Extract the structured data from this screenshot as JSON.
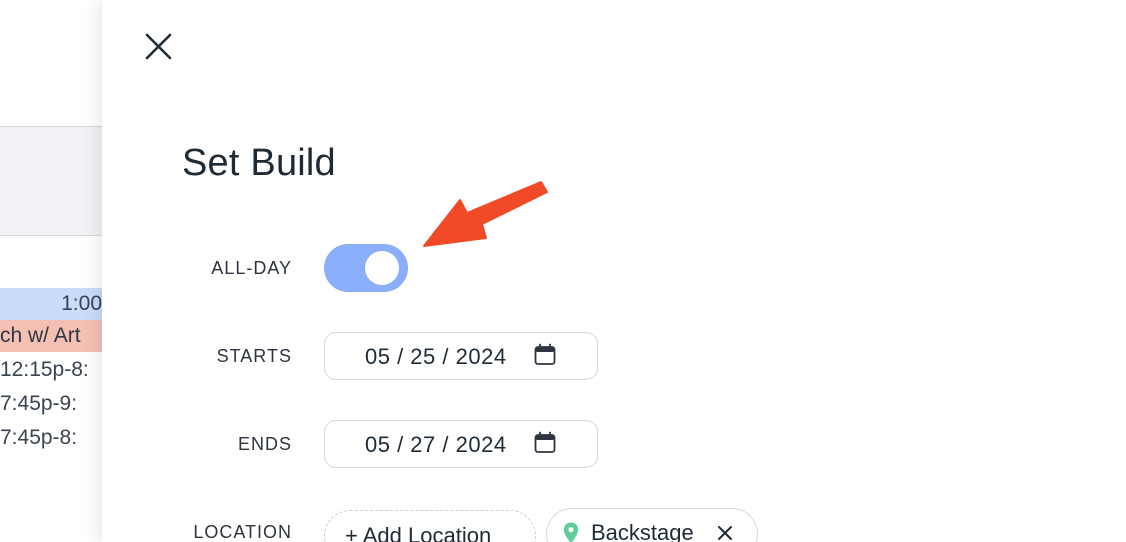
{
  "background_calendar": {
    "rows": [
      {
        "text": "1:00"
      },
      {
        "text": "ch w/ Art"
      },
      {
        "text": "12:15p-8:"
      },
      {
        "text": "7:45p-9:"
      },
      {
        "text": "7:45p-8:"
      }
    ]
  },
  "drawer": {
    "title": "Set Build",
    "close_icon": "close-icon",
    "all_day": {
      "label": "ALL-DAY",
      "on": true,
      "color": "#8aaef9"
    },
    "starts": {
      "label": "STARTS",
      "value": "05 / 25 / 2024",
      "icon": "calendar-icon"
    },
    "ends": {
      "label": "ENDS",
      "value": "05 / 27 / 2024",
      "icon": "calendar-icon"
    },
    "location": {
      "label": "LOCATION",
      "add_label": "+ Add Location",
      "selected": [
        {
          "name": "Backstage",
          "pin_color": "#5fcf9a"
        }
      ]
    }
  },
  "annotation": {
    "arrow_color": "#f14a26"
  }
}
